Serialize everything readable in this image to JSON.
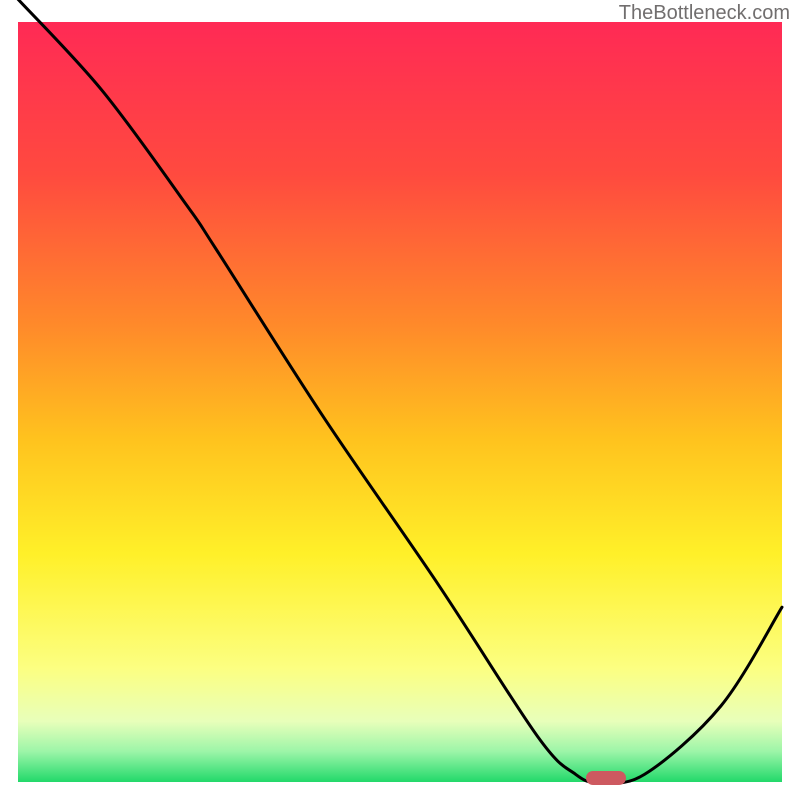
{
  "watermark": "TheBottleneck.com",
  "chart_data": {
    "type": "line",
    "title": "",
    "xlabel": "",
    "ylabel": "",
    "xlim": [
      0,
      100
    ],
    "ylim": [
      0,
      100
    ],
    "x": [
      0,
      11,
      22,
      26,
      40,
      55,
      68,
      73,
      76,
      82,
      92,
      100
    ],
    "values": [
      103,
      91,
      76,
      70,
      48,
      26,
      6,
      1,
      0,
      1,
      10,
      23
    ],
    "gradient_stops": [
      {
        "pos": 0.0,
        "color": "#ff2a55"
      },
      {
        "pos": 0.2,
        "color": "#ff4a3f"
      },
      {
        "pos": 0.4,
        "color": "#ff8a2a"
      },
      {
        "pos": 0.55,
        "color": "#ffc31e"
      },
      {
        "pos": 0.7,
        "color": "#fff029"
      },
      {
        "pos": 0.85,
        "color": "#fcff81"
      },
      {
        "pos": 0.92,
        "color": "#e8ffba"
      },
      {
        "pos": 0.96,
        "color": "#9cf5a8"
      },
      {
        "pos": 1.0,
        "color": "#22d96a"
      }
    ],
    "marker": {
      "x": 77,
      "y": 0.5,
      "color": "#cd5960"
    }
  }
}
